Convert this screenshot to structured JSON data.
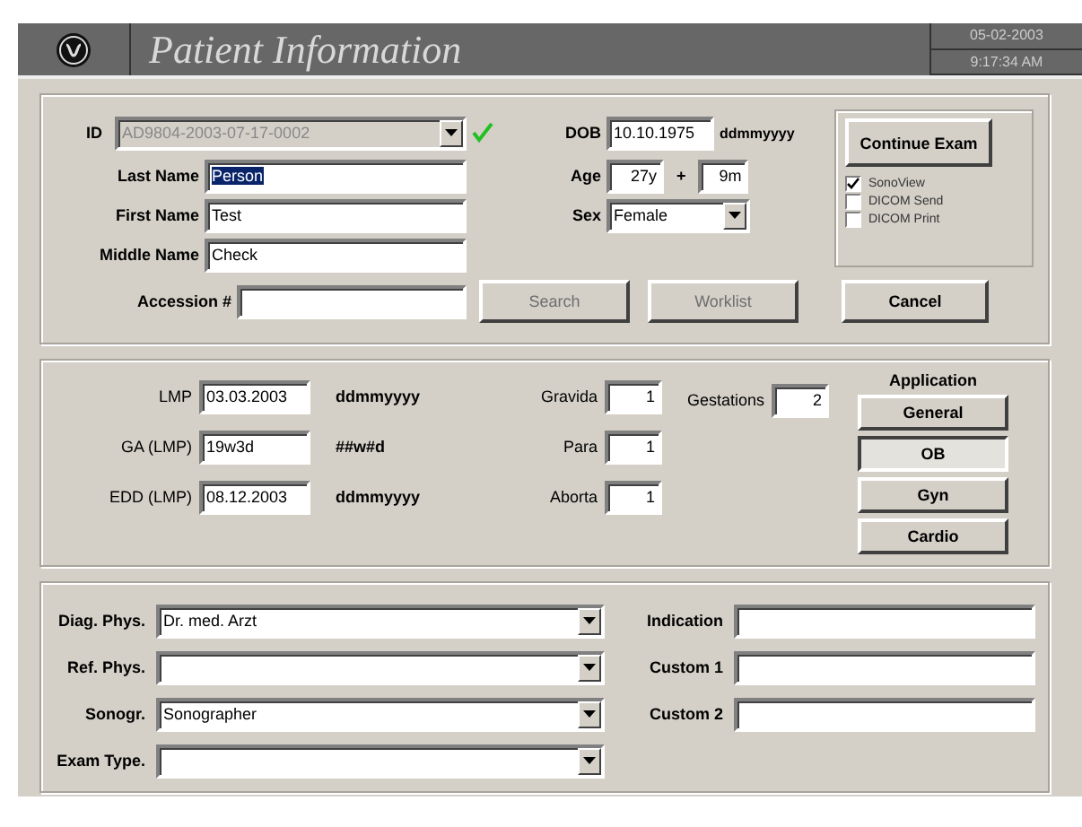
{
  "header": {
    "title": "Patient Information",
    "date": "05-02-2003",
    "time": "9:17:34 AM"
  },
  "patient": {
    "id": {
      "label": "ID",
      "value": "AD9804-2003-07-17-0002",
      "disabled": true,
      "verified": true
    },
    "names": [
      {
        "label": "Last Name",
        "value": "Person",
        "selected": true
      },
      {
        "label": "First Name",
        "value": "Test",
        "selected": false
      },
      {
        "label": "Middle Name",
        "value": "Check",
        "selected": false
      }
    ],
    "accession": {
      "label": "Accession #"
    },
    "dob": {
      "label": "DOB",
      "value": "10.10.1975",
      "format": "ddmmyyyy"
    },
    "age": {
      "label": "Age",
      "years": "27y",
      "separator": "+",
      "months": "9m"
    },
    "sex": {
      "label": "Sex",
      "value": "Female"
    },
    "buttons": [
      {
        "label": "Search",
        "disabled": true
      },
      {
        "label": "Worklist",
        "disabled": true
      }
    ],
    "continue_button": "Continue Exam",
    "options": [
      {
        "label": "SonoView",
        "checked": true
      },
      {
        "label": "DICOM Send",
        "checked": false
      },
      {
        "label": "DICOM Print",
        "checked": false
      }
    ],
    "cancel_button": "Cancel"
  },
  "obstetrics": {
    "dates": [
      {
        "label": "LMP",
        "value": "03.03.2003",
        "unit": "ddmmyyyy"
      },
      {
        "label": "GA (LMP)",
        "value": "19w3d",
        "unit": "##w#d"
      },
      {
        "label": "EDD (LMP)",
        "value": "08.12.2003",
        "unit": "ddmmyyyy"
      }
    ],
    "counts": [
      {
        "label": "Gravida",
        "value": "1"
      },
      {
        "label": "Para",
        "value": "1"
      },
      {
        "label": "Aborta",
        "value": "1"
      }
    ],
    "gestations": {
      "label": "Gestations",
      "value": "2"
    },
    "application": {
      "title": "Application",
      "options": [
        {
          "label": "General",
          "selected": false
        },
        {
          "label": "OB",
          "selected": true
        },
        {
          "label": "Gyn",
          "selected": false
        },
        {
          "label": "Cardio",
          "selected": false
        }
      ]
    }
  },
  "exam": {
    "combos": [
      {
        "label": "Diag. Phys.",
        "value": "Dr. med. Arzt"
      },
      {
        "label": "Ref. Phys."
      },
      {
        "label": "Sonogr.",
        "value": "Sonographer"
      },
      {
        "label": "Exam Type."
      }
    ],
    "fields": [
      {
        "label": "Indication"
      },
      {
        "label": "Custom 1"
      },
      {
        "label": "Custom 2"
      }
    ]
  }
}
